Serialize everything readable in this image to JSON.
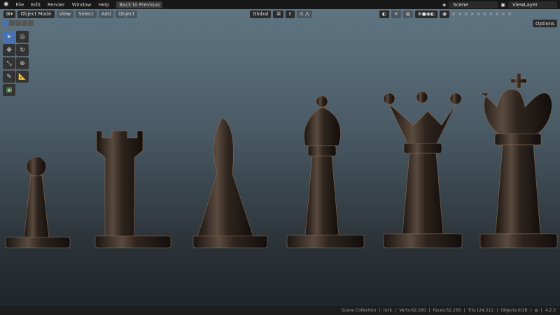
{
  "topbar": {
    "menus": [
      "File",
      "Edit",
      "Render",
      "Window",
      "Help"
    ],
    "back_button": "Back to Previous",
    "scene": "Scene",
    "view_layer": "ViewLayer"
  },
  "header": {
    "mode": "Object Mode",
    "menus": [
      "View",
      "Select",
      "Add",
      "Object"
    ],
    "orientation": "Global",
    "options": "Options"
  },
  "status": {
    "collection": "Scene Collection",
    "object": "rock",
    "verts": "Verts:62,260",
    "faces": "Faces:62,256",
    "tris": "Tris:124,512",
    "objects": "Objects:0/18",
    "version": "4.2.3"
  },
  "colors": {
    "accent": "#4772b3",
    "piece": "#2a211c"
  }
}
